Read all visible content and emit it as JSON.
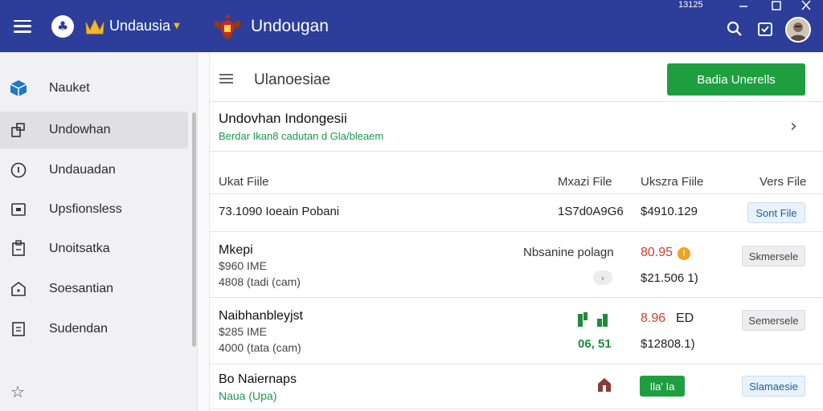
{
  "topbar": {
    "app_name": "Undausia",
    "title": "Undougan",
    "clock": "13125"
  },
  "sidebar": {
    "items": [
      {
        "label": "Nauket",
        "icon": "cube-icon"
      },
      {
        "label": "Undowhan",
        "icon": "grid-icon"
      },
      {
        "label": "Undauadan",
        "icon": "info-icon"
      },
      {
        "label": "Upsfionsless",
        "icon": "screen-icon"
      },
      {
        "label": "Unoitsatka",
        "icon": "device-icon"
      },
      {
        "label": "Soesantian",
        "icon": "house-icon"
      },
      {
        "label": "Sudendan",
        "icon": "list-icon"
      }
    ],
    "active_index": 1
  },
  "main": {
    "title": "Ulanoesiae",
    "primary_button": "Badia Unerells",
    "banner": {
      "title": "Undovhan Indongesii",
      "subtitle": "Berdar Ikan8 cadutan d Gla/bleaem"
    },
    "columns": [
      "Ukat Fiile",
      "Mxazi File",
      "Ukszra Fiile",
      "Vers File"
    ],
    "rows": [
      {
        "name": "73.1090 Ioeain Pobani",
        "col2": "1S7d0A9G6",
        "col3": "$4910.129",
        "button": "Sont File"
      },
      {
        "name": "Mkepi",
        "line2": "$960 IME",
        "line3": "4808 (tadi (cam)",
        "col2": "Nbsanine polagn",
        "col3_top": "80.95",
        "col3_bottom": "$21.506 1)",
        "button": "Skmersele"
      },
      {
        "name": "Naibhanbleyjst",
        "line2": "$285 IME",
        "line3": "4000 (tata (cam)",
        "col2": "06, 51",
        "col3_top": "8.96",
        "col3_unit": "ED",
        "col3_bottom": "$12808.1)",
        "button": "Semersele"
      },
      {
        "name": "Bo Naiernaps",
        "line2": "Naua (Upa)",
        "status": "Ila' Ia",
        "button": "Slamaesie"
      }
    ]
  },
  "colors": {
    "topbar": "#2c3d9a",
    "primary": "#1f9e3f",
    "accent_link": "#1a9a48",
    "warn": "#f2a21d",
    "price_red": "#c9412e"
  }
}
